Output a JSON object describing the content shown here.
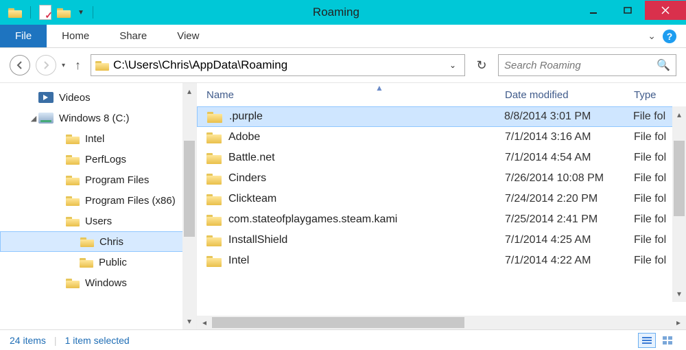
{
  "window": {
    "title": "Roaming"
  },
  "ribbon": {
    "file": "File",
    "tabs": [
      "Home",
      "Share",
      "View"
    ]
  },
  "address": {
    "path": "C:\\Users\\Chris\\AppData\\Roaming"
  },
  "search": {
    "placeholder": "Search Roaming"
  },
  "tree": [
    {
      "label": "Videos",
      "indent": 42,
      "icon": "video",
      "exp": ""
    },
    {
      "label": "Windows 8 (C:)",
      "indent": 42,
      "icon": "drive",
      "exp": "◢"
    },
    {
      "label": "Intel",
      "indent": 82,
      "icon": "folder",
      "exp": ""
    },
    {
      "label": "PerfLogs",
      "indent": 82,
      "icon": "folder",
      "exp": ""
    },
    {
      "label": "Program Files",
      "indent": 82,
      "icon": "folder",
      "exp": ""
    },
    {
      "label": "Program Files (x86)",
      "indent": 82,
      "icon": "folder",
      "exp": ""
    },
    {
      "label": "Users",
      "indent": 82,
      "icon": "folder",
      "exp": ""
    },
    {
      "label": "Chris",
      "indent": 102,
      "icon": "folder",
      "exp": "",
      "selected": true
    },
    {
      "label": "Public",
      "indent": 102,
      "icon": "folder",
      "exp": ""
    },
    {
      "label": "Windows",
      "indent": 82,
      "icon": "folder",
      "exp": ""
    }
  ],
  "columns": {
    "name": "Name",
    "date": "Date modified",
    "type": "Type"
  },
  "rows": [
    {
      "name": ".purple",
      "date": "8/8/2014 3:01 PM",
      "type": "File folder",
      "selected": true
    },
    {
      "name": "Adobe",
      "date": "7/1/2014 3:16 AM",
      "type": "File folder"
    },
    {
      "name": "Battle.net",
      "date": "7/1/2014 4:54 AM",
      "type": "File folder"
    },
    {
      "name": "Cinders",
      "date": "7/26/2014 10:08 PM",
      "type": "File folder"
    },
    {
      "name": "Clickteam",
      "date": "7/24/2014 2:20 PM",
      "type": "File folder"
    },
    {
      "name": "com.stateofplaygames.steam.kami",
      "date": "7/25/2014 2:41 PM",
      "type": "File folder"
    },
    {
      "name": "InstallShield",
      "date": "7/1/2014 4:25 AM",
      "type": "File folder"
    },
    {
      "name": "Intel",
      "date": "7/1/2014 4:22 AM",
      "type": "File folder"
    }
  ],
  "status": {
    "count": "24 items",
    "selection": "1 item selected"
  }
}
